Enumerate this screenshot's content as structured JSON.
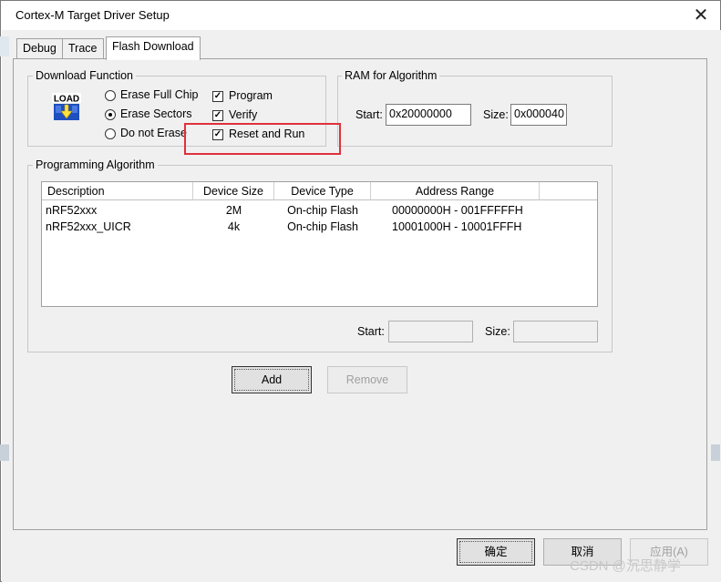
{
  "window": {
    "title": "Cortex-M Target Driver Setup",
    "close_glyph": "✕"
  },
  "tabs": [
    {
      "label": "Debug",
      "active": false
    },
    {
      "label": "Trace",
      "active": false
    },
    {
      "label": "Flash Download",
      "active": true
    }
  ],
  "download_function": {
    "label": "Download Function",
    "icon_text": "LOAD",
    "radios": [
      {
        "label": "Erase Full Chip",
        "selected": false
      },
      {
        "label": "Erase Sectors",
        "selected": true
      },
      {
        "label": "Do not Erase",
        "selected": false
      }
    ],
    "checks": [
      {
        "label": "Program",
        "checked": true
      },
      {
        "label": "Verify",
        "checked": true
      },
      {
        "label": "Reset and Run",
        "checked": true
      }
    ]
  },
  "ram": {
    "label": "RAM for Algorithm",
    "start_label": "Start:",
    "start_value": "0x20000000",
    "size_label": "Size:",
    "size_value": "0x000040"
  },
  "programming": {
    "label": "Programming Algorithm",
    "columns": [
      "Description",
      "Device Size",
      "Device Type",
      "Address Range"
    ],
    "rows": [
      {
        "description": "nRF52xxx",
        "size": "2M",
        "type": "On-chip Flash",
        "range": "00000000H - 001FFFFFH"
      },
      {
        "description": "nRF52xxx_UICR",
        "size": "4k",
        "type": "On-chip Flash",
        "range": "10001000H - 10001FFFH"
      }
    ],
    "start_label": "Start:",
    "size_label": "Size:"
  },
  "buttons": {
    "add": "Add",
    "remove": "Remove",
    "ok": "确定",
    "cancel": "取消",
    "apply": "应用(A)"
  },
  "watermark": "CSDN @沉思静学",
  "colors": {
    "highlight": "#e0303a"
  }
}
